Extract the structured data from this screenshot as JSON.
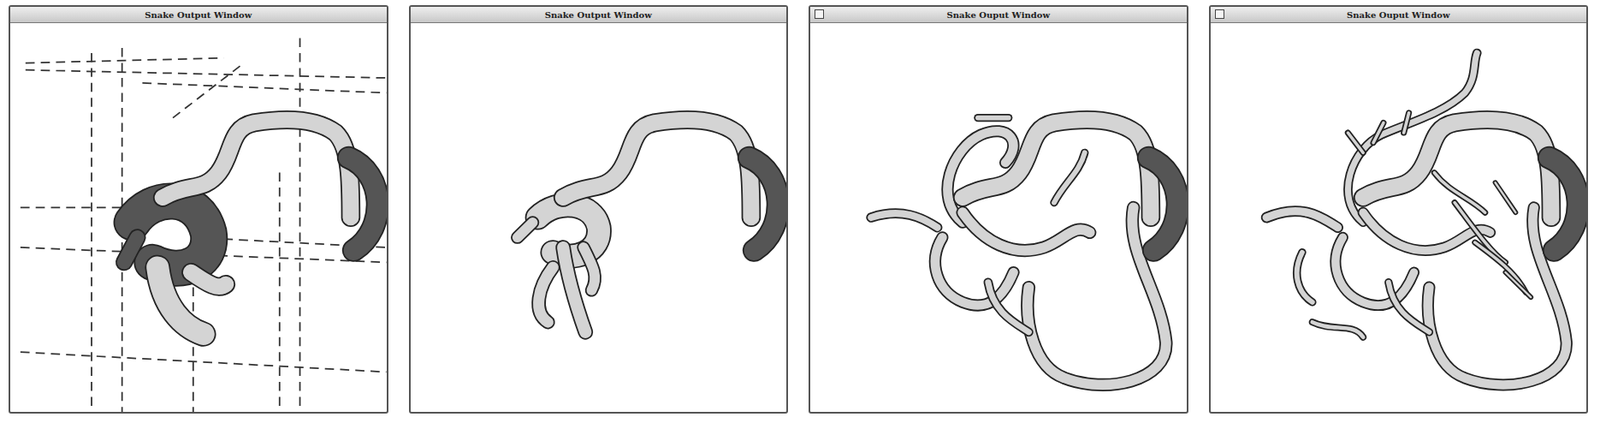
{
  "windows": [
    {
      "title": "Snake Output Window",
      "close_box": false,
      "grid": true
    },
    {
      "title": "Snake Output Window",
      "close_box": false,
      "grid": false
    },
    {
      "title": "Snake Ouput Window",
      "close_box": true,
      "grid": false
    },
    {
      "title": "Snake Ouput Window",
      "close_box": true,
      "grid": false
    }
  ]
}
